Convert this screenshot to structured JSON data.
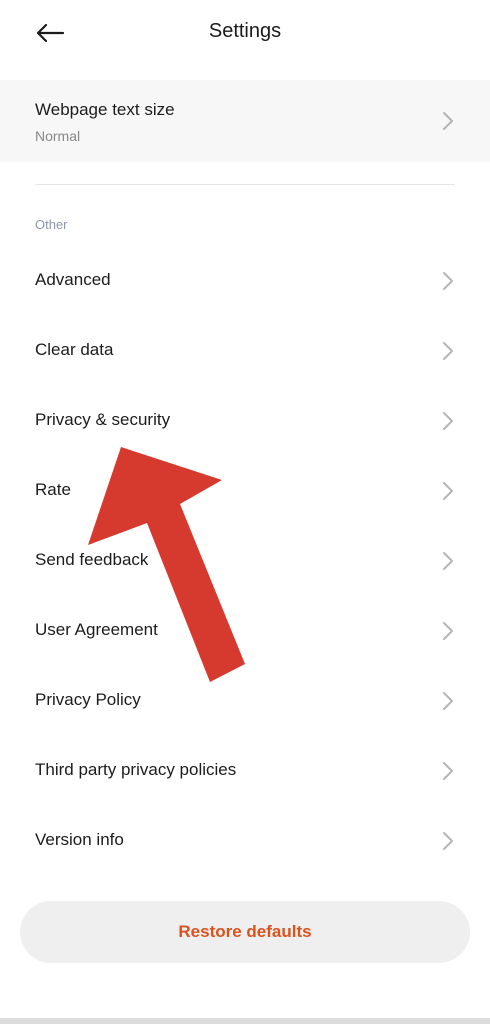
{
  "header": {
    "title": "Settings",
    "back_icon": "arrow-left-icon"
  },
  "text_size": {
    "title": "Webpage text size",
    "value": "Normal"
  },
  "section": {
    "label": "Other"
  },
  "items": [
    {
      "label": "Advanced"
    },
    {
      "label": "Clear data"
    },
    {
      "label": "Privacy & security"
    },
    {
      "label": "Rate"
    },
    {
      "label": "Send feedback"
    },
    {
      "label": "User Agreement"
    },
    {
      "label": "Privacy Policy"
    },
    {
      "label": "Third party privacy policies"
    },
    {
      "label": "Version info"
    }
  ],
  "footer": {
    "restore_label": "Restore defaults"
  },
  "colors": {
    "accent": "#d9531e",
    "annotation_arrow": "#d63a2f",
    "section_label": "#8e96a8"
  }
}
